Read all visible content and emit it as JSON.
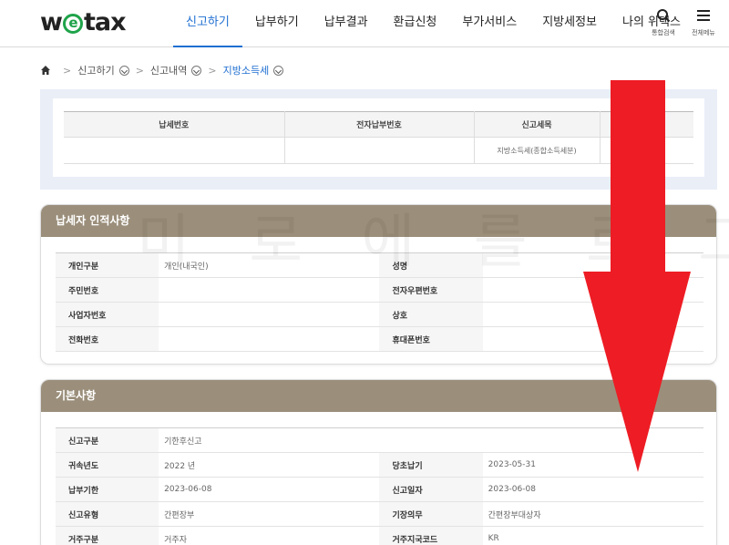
{
  "header": {
    "logo": {
      "prefix": "w",
      "e": "e",
      "suffix": "tax"
    },
    "nav": [
      "신고하기",
      "납부하기",
      "납부결과",
      "환급신청",
      "부가서비스",
      "지방세정보",
      "나의 위택스"
    ],
    "search_label": "통합검색",
    "menu_label": "전체메뉴"
  },
  "breadcrumb": {
    "items": [
      "신고하기",
      "신고내역"
    ],
    "current": "지방소득세"
  },
  "summary": {
    "headers": [
      "납세번호",
      "전자납부번호",
      "신고세목",
      ""
    ],
    "row": [
      "",
      "",
      "지방소득세(종합소득세분)",
      ""
    ]
  },
  "watermark": "미 로 에 를 로 그",
  "section1": {
    "title": "납세자 인적사항",
    "rows": [
      {
        "l1": "개인구분",
        "v1": "개인(내국인)",
        "l2": "성명",
        "v2": ""
      },
      {
        "l1": "주민번호",
        "v1": "",
        "l2": "전자우편번호",
        "v2": ""
      },
      {
        "l1": "사업자번호",
        "v1": "",
        "l2": "상호",
        "v2": ""
      },
      {
        "l1": "전화번호",
        "v1": "",
        "l2": "휴대폰번호",
        "v2": ""
      }
    ]
  },
  "section2": {
    "title": "기본사항",
    "row0": {
      "l1": "신고구분",
      "v1": "기한후신고"
    },
    "rows": [
      {
        "l1": "귀속년도",
        "v1": "2022 년",
        "l2": "당초납기",
        "v2": "2023-05-31"
      },
      {
        "l1": "납부기한",
        "v1": "2023-06-08",
        "l2": "신고일자",
        "v2": "2023-06-08"
      },
      {
        "l1": "신고유형",
        "v1": "간편장부",
        "l2": "기장의무",
        "v2": "간편장부대상자"
      },
      {
        "l1": "거주구분",
        "v1": "거주자",
        "l2": "거주지국코드",
        "v2": "KR"
      }
    ]
  },
  "colors": {
    "accent": "#1f6fd1",
    "logo_green": "#1fa34a",
    "section_header": "#9b8f7b",
    "summary_bg": "#e9eef7",
    "arrow": "#ee1c24"
  }
}
